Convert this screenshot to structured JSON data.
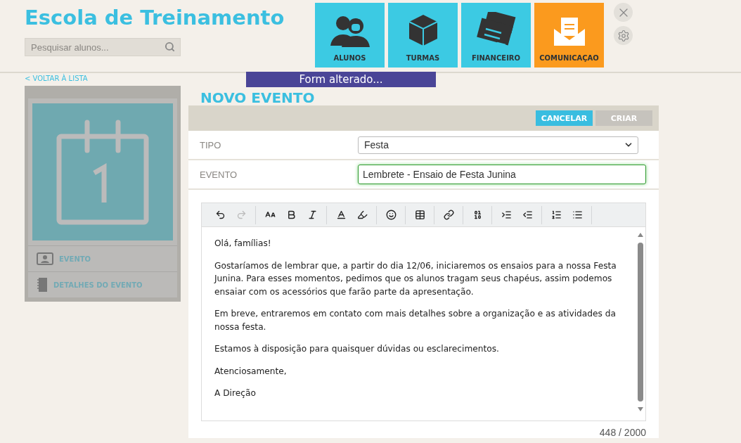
{
  "header": {
    "title": "Escola de Treinamento",
    "search": {
      "placeholder": "Pesquisar alunos..."
    }
  },
  "nav_tiles": [
    {
      "kind": "students",
      "label": "ALUNOS",
      "selected": false
    },
    {
      "kind": "box",
      "label": "TURMAS",
      "selected": false
    },
    {
      "kind": "money",
      "label": "FINANCEIRO",
      "selected": false
    },
    {
      "kind": "mail",
      "label": "COMUNICAÇAO",
      "selected": true
    }
  ],
  "back_link": "< VOLTAR À LISTA",
  "toast": "Form alterado...",
  "sidebar": {
    "items": [
      {
        "kind": "contact",
        "label": "EVENTO"
      },
      {
        "kind": "notebook",
        "label": "DETALHES DO EVENTO"
      }
    ]
  },
  "page_title": "NOVO EVENTO",
  "actions": [
    {
      "kind": "primary",
      "label": "CANCELAR"
    },
    {
      "kind": "secondary",
      "label": "CRIAR"
    }
  ],
  "fields": [
    {
      "kind": "select",
      "label": "TIPO",
      "value": "Festa"
    },
    {
      "kind": "text",
      "label": "EVENTO",
      "value": "Lembrete - Ensaio de Festa Junina"
    }
  ],
  "editor": {
    "paragraphs": [
      "Olá, famílias!",
      "Gostaríamos de lembrar que, a partir do dia 12/06, iniciaremos os ensaios para a nossa Festa Junina. Para esses momentos, pedimos que os alunos tragam seus chapéus, assim podemos ensaiar com os acessórios que farão parte da apresentação.",
      "Em breve, entraremos em contato com mais detalhes sobre a organização e as atividades da nossa festa.",
      "Estamos à disposição para quaisquer dúvidas ou esclarecimentos.",
      "Atenciosamente,",
      "A Direção"
    ],
    "counter": "448 / 2000"
  }
}
